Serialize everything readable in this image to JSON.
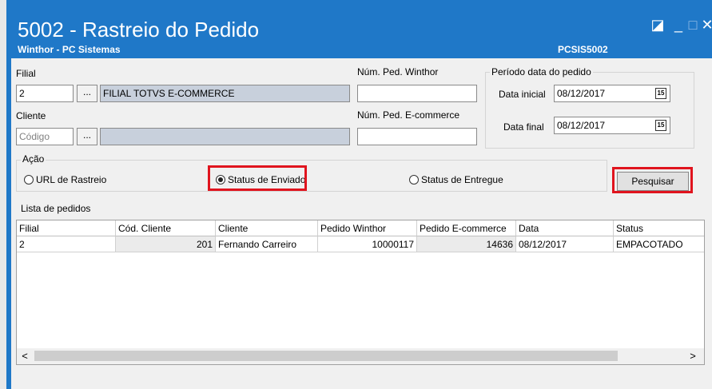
{
  "window": {
    "title": "5002 - Rastreio do Pedido",
    "subtitle": "Winthor - PC Sistemas",
    "code": "PCSIS5002"
  },
  "filial": {
    "label": "Filial",
    "value": "2",
    "lookup_label": "...",
    "name": "FILIAL TOTVS E-COMMERCE"
  },
  "cliente": {
    "label": "Cliente",
    "placeholder": "Código",
    "lookup_label": "...",
    "name": ""
  },
  "num_ped_winthor": {
    "label": "Núm. Ped. Winthor",
    "value": ""
  },
  "num_ped_ecommerce": {
    "label": "Núm. Ped. E-commerce",
    "value": ""
  },
  "periodo": {
    "label": "Período data do pedido",
    "data_inicial_label": "Data inicial",
    "data_inicial": "08/12/2017",
    "data_final_label": "Data final",
    "data_final": "08/12/2017",
    "calendar_icon": "15"
  },
  "acao": {
    "label": "Ação",
    "options": [
      "URL de Rastreio",
      "Status de Enviado",
      "Status de Entregue"
    ],
    "selected": "Status de Enviado"
  },
  "search_button": "Pesquisar",
  "lista": {
    "label": "Lista de pedidos",
    "columns": [
      "Filial",
      "Cód. Cliente",
      "Cliente",
      "Pedido Winthor",
      "Pedido E-commerce",
      "Data",
      "Status"
    ],
    "rows": [
      [
        "2",
        "201",
        "Fernando Carreiro",
        "10000117",
        "14636",
        "08/12/2017",
        "EMPACOTADO"
      ]
    ]
  },
  "scroll": {
    "left": "<",
    "right": ">"
  },
  "colors": {
    "titlebar": "#1f78c8",
    "highlight": "#e0141e"
  }
}
